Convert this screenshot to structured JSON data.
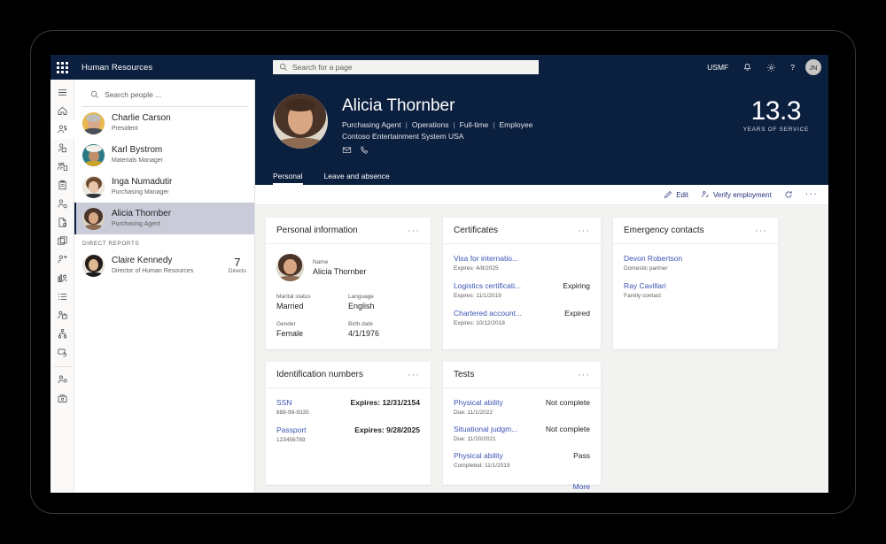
{
  "topnav": {
    "waffle_icon": "waffle-grid-icon",
    "app_title": "Human Resources",
    "page_search_placeholder": "Search for a page",
    "search_icon": "search-icon",
    "company": "USMF",
    "bell_icon": "notification-bell-icon",
    "gear_icon": "settings-gear-icon",
    "help_label": "?",
    "user_initials": "JN"
  },
  "rail": {
    "items": [
      {
        "name": "hamburger-menu-icon",
        "label": "Menu"
      },
      {
        "name": "home-icon",
        "label": "Home"
      },
      {
        "name": "people-network-icon",
        "label": "Workforce"
      },
      {
        "name": "person-badge-icon",
        "label": "Employees"
      },
      {
        "name": "org-group-icon",
        "label": "Teams"
      },
      {
        "name": "clipboard-icon",
        "label": "Tasks"
      },
      {
        "name": "person-settings-icon",
        "label": "Personnel management"
      },
      {
        "name": "document-check-icon",
        "label": "Documents"
      },
      {
        "name": "id-card-icon",
        "label": "Records"
      },
      {
        "name": "person-add-icon",
        "label": "Recruitment"
      },
      {
        "name": "chart-person-icon",
        "label": "Analytics"
      },
      {
        "name": "list-icon",
        "label": "Lists"
      },
      {
        "name": "briefcase-person-icon",
        "label": "Jobs"
      },
      {
        "name": "hierarchy-icon",
        "label": "Organization"
      },
      {
        "name": "shield-screen-icon",
        "label": "Compliance"
      },
      {
        "name": "person-gear-icon",
        "label": "Settings"
      },
      {
        "name": "briefcase-icon",
        "label": "Benefits"
      }
    ],
    "active_index": 2
  },
  "people_panel": {
    "search_placeholder": "Search people ...",
    "search_icon": "search-icon",
    "people": [
      {
        "name": "Charlie Carson",
        "title": "President",
        "selected": false
      },
      {
        "name": "Karl Bystrom",
        "title": "Materials Manager",
        "selected": false
      },
      {
        "name": "Inga Numadutir",
        "title": "Purchasing Manager",
        "selected": false
      },
      {
        "name": "Alicia Thornber",
        "title": "Purchasing Agent",
        "selected": true
      }
    ],
    "direct_reports_label": "DIRECT REPORTS",
    "direct_reports": [
      {
        "name": "Claire Kennedy",
        "title": "Director of Human Resources",
        "count": "7",
        "count_label": "Directs"
      }
    ]
  },
  "hero": {
    "employee_name": "Alicia Thornber",
    "meta": [
      "Purchasing Agent",
      "Operations",
      "Full-time",
      "Employee"
    ],
    "company": "Contoso Entertainment System USA",
    "email_icon": "email-envelope-icon",
    "phone_icon": "phone-icon",
    "years_of_service_value": "13.3",
    "years_of_service_label": "YEARS OF SERVICE",
    "tabs": [
      {
        "label": "Personal",
        "active": true
      },
      {
        "label": "Leave and absence",
        "active": false
      }
    ]
  },
  "actionbar": {
    "edit_icon": "pencil-edit-icon",
    "edit_label": "Edit",
    "verify_icon": "person-verify-icon",
    "verify_label": "Verify employment",
    "refresh_icon": "refresh-circle-icon",
    "overflow_icon": "ellipsis-icon"
  },
  "cards": {
    "personal_information": {
      "title": "Personal information",
      "overflow_icon": "ellipsis-icon",
      "avatar_name": "employee-avatar",
      "name_label": "Name",
      "name_value": "Alicia Thornber",
      "fields": [
        {
          "label": "Marital status",
          "value": "Married"
        },
        {
          "label": "Language",
          "value": "English"
        },
        {
          "label": "Gender",
          "value": "Female"
        },
        {
          "label": "Birth date",
          "value": "4/1/1976"
        }
      ]
    },
    "certificates": {
      "title": "Certificates",
      "overflow_icon": "ellipsis-icon",
      "items": [
        {
          "link": "Visa for internatio...",
          "sub": "Expires: 4/8/2025",
          "status": ""
        },
        {
          "link": "Logistics certificati...",
          "sub": "Expires: 11/1/2019",
          "status": "Expiring"
        },
        {
          "link": "Chartered account...",
          "sub": "Expires: 10/12/2018",
          "status": "Expired"
        }
      ]
    },
    "emergency_contacts": {
      "title": "Emergency contacts",
      "overflow_icon": "ellipsis-icon",
      "items": [
        {
          "link": "Devon Robertson",
          "sub": "Domestic partner"
        },
        {
          "link": "Ray Cavillari",
          "sub": "Family contact"
        }
      ]
    },
    "identification_numbers": {
      "title": "Identification numbers",
      "overflow_icon": "ellipsis-icon",
      "items": [
        {
          "link": "SSN",
          "sub": "888-99-9335",
          "status": "Expires: 12/31/2154"
        },
        {
          "link": "Passport",
          "sub": "123456789",
          "status": "Expires: 9/28/2025"
        }
      ]
    },
    "tests": {
      "title": "Tests",
      "overflow_icon": "ellipsis-icon",
      "items": [
        {
          "link": "Physical ability",
          "sub": "Due: 11/1/2022",
          "status": "Not complete"
        },
        {
          "link": "Situational judgm...",
          "sub": "Due: 11/20/2021",
          "status": "Not complete"
        },
        {
          "link": "Physical ability",
          "sub": "Completed: 11/1/2019",
          "status": "Pass"
        }
      ],
      "more_label": "More"
    }
  },
  "colors": {
    "nav_dark": "#0b1f3f",
    "page_bg": "#f2f2f0",
    "card_bg": "#ffffff",
    "link_blue": "#3a54b4",
    "action_blue": "#24317a",
    "selected_row": "#c9cbd8"
  }
}
